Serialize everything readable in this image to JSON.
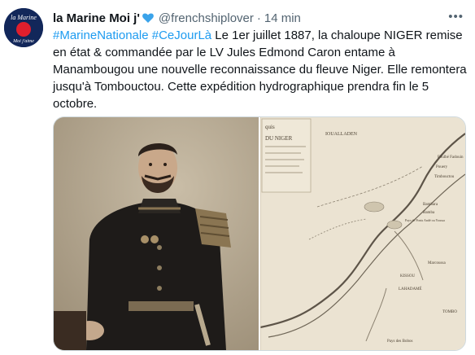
{
  "tweet": {
    "display_name": "la Marine Moi j'",
    "handle": "@frenchshiplover",
    "separator": "·",
    "time": "14 min",
    "more_icon": "more-horizontal-icon",
    "avatar": {
      "text_line1": "la Marine",
      "text_line2": "Moi j'aime",
      "colors": {
        "background": "#12275a",
        "circle": "#e01f2d"
      }
    },
    "verified_heart_color": "#3aa3ea",
    "hashtags": [
      "#MarineNationale",
      "#CeJourLà"
    ],
    "text": " Le 1er juillet 1887, la chaloupe NIGER remise en état & commandée par le LV Jules Edmond Caron entame à Manambougou une nouvelle reconnaissance du fleuve Niger. Elle remontera jusqu'à Tombouctou. Cette expédition hydrographique prendra fin le 5 octobre.",
    "media": {
      "map_labels": {
        "title_1": "quis",
        "title_2": "DU NIGER",
        "oualladen": "IOUALLADEN",
        "fadouin": "Foulbé Fadouin",
        "powry": "Pouery",
        "tim": "Timbouctou",
        "oulad": "Oulad",
        "bambara": "Bambara",
        "bamba": "Bamba",
        "plateau": "Pays de Ponts Andé ou Youssa",
        "marcouss": "Marcoussa",
        "kissou": "KISSOU",
        "lahadamé": "LAHADAMÉ",
        "tomboria": "TOMBO",
        "niger_river_label": "Pays des Bobos"
      }
    }
  }
}
